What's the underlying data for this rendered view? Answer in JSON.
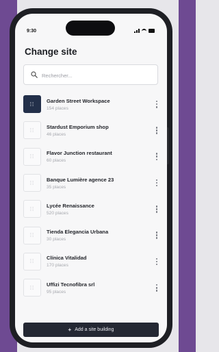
{
  "status_bar": {
    "time": "9:30"
  },
  "header": {
    "title": "Change site"
  },
  "search": {
    "placeholder": "Rechercher...",
    "value": ""
  },
  "sites": [
    {
      "name": "Garden Street Workspace",
      "places": "154 places",
      "active": true
    },
    {
      "name": "Stardust Emporium shop",
      "places": "46 places",
      "active": false
    },
    {
      "name": "Flavor Junction restaurant",
      "places": "60 places",
      "active": false
    },
    {
      "name": "Banque Lumière agence 23",
      "places": "35 places",
      "active": false
    },
    {
      "name": "Lycée Renaissance",
      "places": "520 places",
      "active": false
    },
    {
      "name": "Tienda Elegancia Urbana",
      "places": "30 places",
      "active": false
    },
    {
      "name": "Clínica Vitalidad",
      "places": "170 places",
      "active": false
    },
    {
      "name": "Uffizi Tecnofibra srl",
      "places": "95 places",
      "active": false
    }
  ],
  "footer": {
    "add_label": "Add a site building"
  },
  "colors": {
    "accent": "#23304a",
    "frame": "#1e1f24",
    "background_left": "#6e4a92"
  }
}
